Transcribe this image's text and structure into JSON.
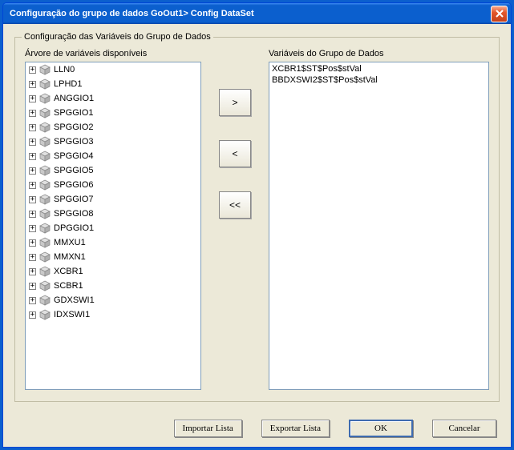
{
  "titlebar": {
    "title": "Configuração do grupo de dados GoOut1> Config DataSet"
  },
  "groupbox": {
    "legend": "Configuração das Variáveis do Grupo de Dados"
  },
  "tree": {
    "label": "Árvore de variáveis disponíveis",
    "items": [
      {
        "name": "LLN0"
      },
      {
        "name": "LPHD1"
      },
      {
        "name": "ANGGIO1"
      },
      {
        "name": "SPGGIO1"
      },
      {
        "name": "SPGGIO2"
      },
      {
        "name": "SPGGIO3"
      },
      {
        "name": "SPGGIO4"
      },
      {
        "name": "SPGGIO5"
      },
      {
        "name": "SPGGIO6"
      },
      {
        "name": "SPGGIO7"
      },
      {
        "name": "SPGGIO8"
      },
      {
        "name": "DPGGIO1"
      },
      {
        "name": "MMXU1"
      },
      {
        "name": "MMXN1"
      },
      {
        "name": "XCBR1"
      },
      {
        "name": "SCBR1"
      },
      {
        "name": "GDXSWI1"
      },
      {
        "name": "IDXSWI1"
      }
    ]
  },
  "selected": {
    "label": "Variáveis do Grupo de Dados",
    "items": [
      "XCBR1$ST$Pos$stVal",
      "BBDXSWI2$ST$Pos$stVal"
    ]
  },
  "buttons": {
    "add": ">",
    "remove": "<",
    "remove_all": "<<",
    "import": "Importar Lista",
    "export": "Exportar Lista",
    "ok": "OK",
    "cancel": "Cancelar"
  }
}
